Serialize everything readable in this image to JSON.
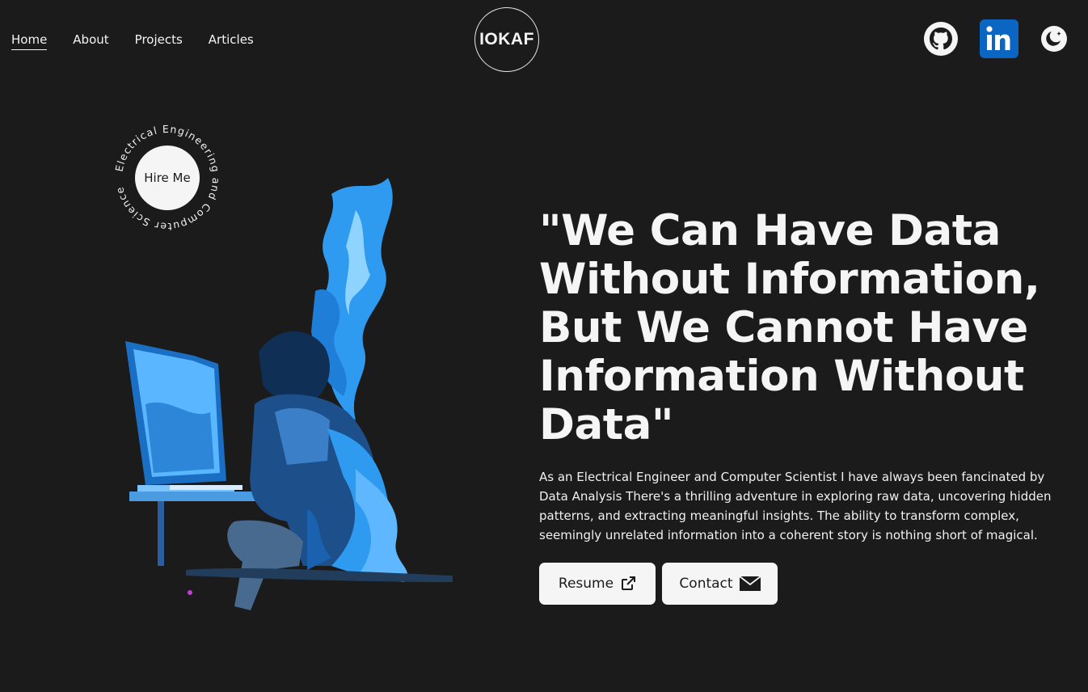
{
  "nav": {
    "items": [
      {
        "label": "Home",
        "active": true
      },
      {
        "label": "About"
      },
      {
        "label": "Projects"
      },
      {
        "label": "Articles"
      }
    ]
  },
  "logo": {
    "text": "IOKAF"
  },
  "social": {
    "icons": [
      "github-icon",
      "linkedin-icon",
      "moon-icon"
    ],
    "linkedin_color": "#0a66c2"
  },
  "hire": {
    "label": "Hire Me",
    "ring_text": "Electrical Engineering and Computer Science"
  },
  "hero": {
    "headline": "\"We Can Have Data Without Information, But We Cannot Have Information Without Data\"",
    "description": "As an Electrical Engineer and Computer Scientist I have always been fancinated by Data Analysis There's a thrilling adventure in exploring raw data, uncovering hidden patterns, and extracting meaningful insights. The ability to transform complex, seemingly unrelated information into a coherent story is nothing short of magical."
  },
  "buttons": {
    "resume": "Resume",
    "contact": "Contact"
  },
  "colors": {
    "background": "#1b1b1b",
    "text": "#f5f5f5",
    "accent_blue": "#2e9bf0"
  }
}
